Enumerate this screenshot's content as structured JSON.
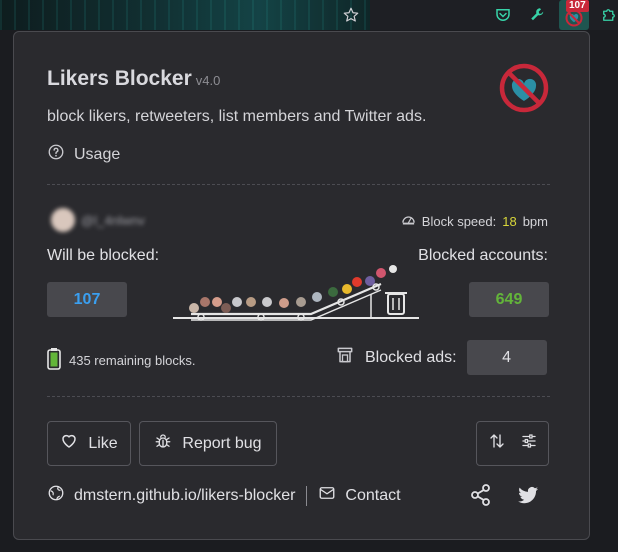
{
  "toolbar": {
    "badge_count": "107"
  },
  "popup": {
    "title": "Likers Blocker",
    "version": "v4.0",
    "subtitle": "block likers, retweeters, list members and Twitter ads.",
    "usage_label": "Usage",
    "user_handle": "@l_4nlwnv",
    "block_speed_label": "Block speed:",
    "block_speed_value": "18",
    "block_speed_unit": "bpm",
    "will_be_blocked_label": "Will be blocked:",
    "will_be_blocked_count": "107",
    "blocked_accounts_label": "Blocked accounts:",
    "blocked_accounts_count": "649",
    "remaining_blocks": "435 remaining blocks.",
    "blocked_ads_label": "Blocked ads:",
    "blocked_ads_count": "4",
    "like_label": "Like",
    "report_bug_label": "Report bug",
    "website_link": "dmstern.github.io/likers-blocker",
    "contact_label": "Contact"
  },
  "colors": {
    "accent_blue": "#3a9ff0",
    "accent_green": "#63b53a",
    "speed_yellow": "#d8d63a",
    "logo_red": "#c8283a",
    "logo_teal": "#2b8fa5"
  },
  "icons": [
    "star-icon",
    "pocket-icon",
    "wrench-icon",
    "likers-blocker-extension-icon",
    "puzzle-icon",
    "question-icon",
    "gauge-icon",
    "battery-icon",
    "ad-icon",
    "heart-icon",
    "bug-icon",
    "sort-icon",
    "sliders-icon",
    "globe-icon",
    "mail-icon",
    "share-icon",
    "twitter-icon"
  ]
}
